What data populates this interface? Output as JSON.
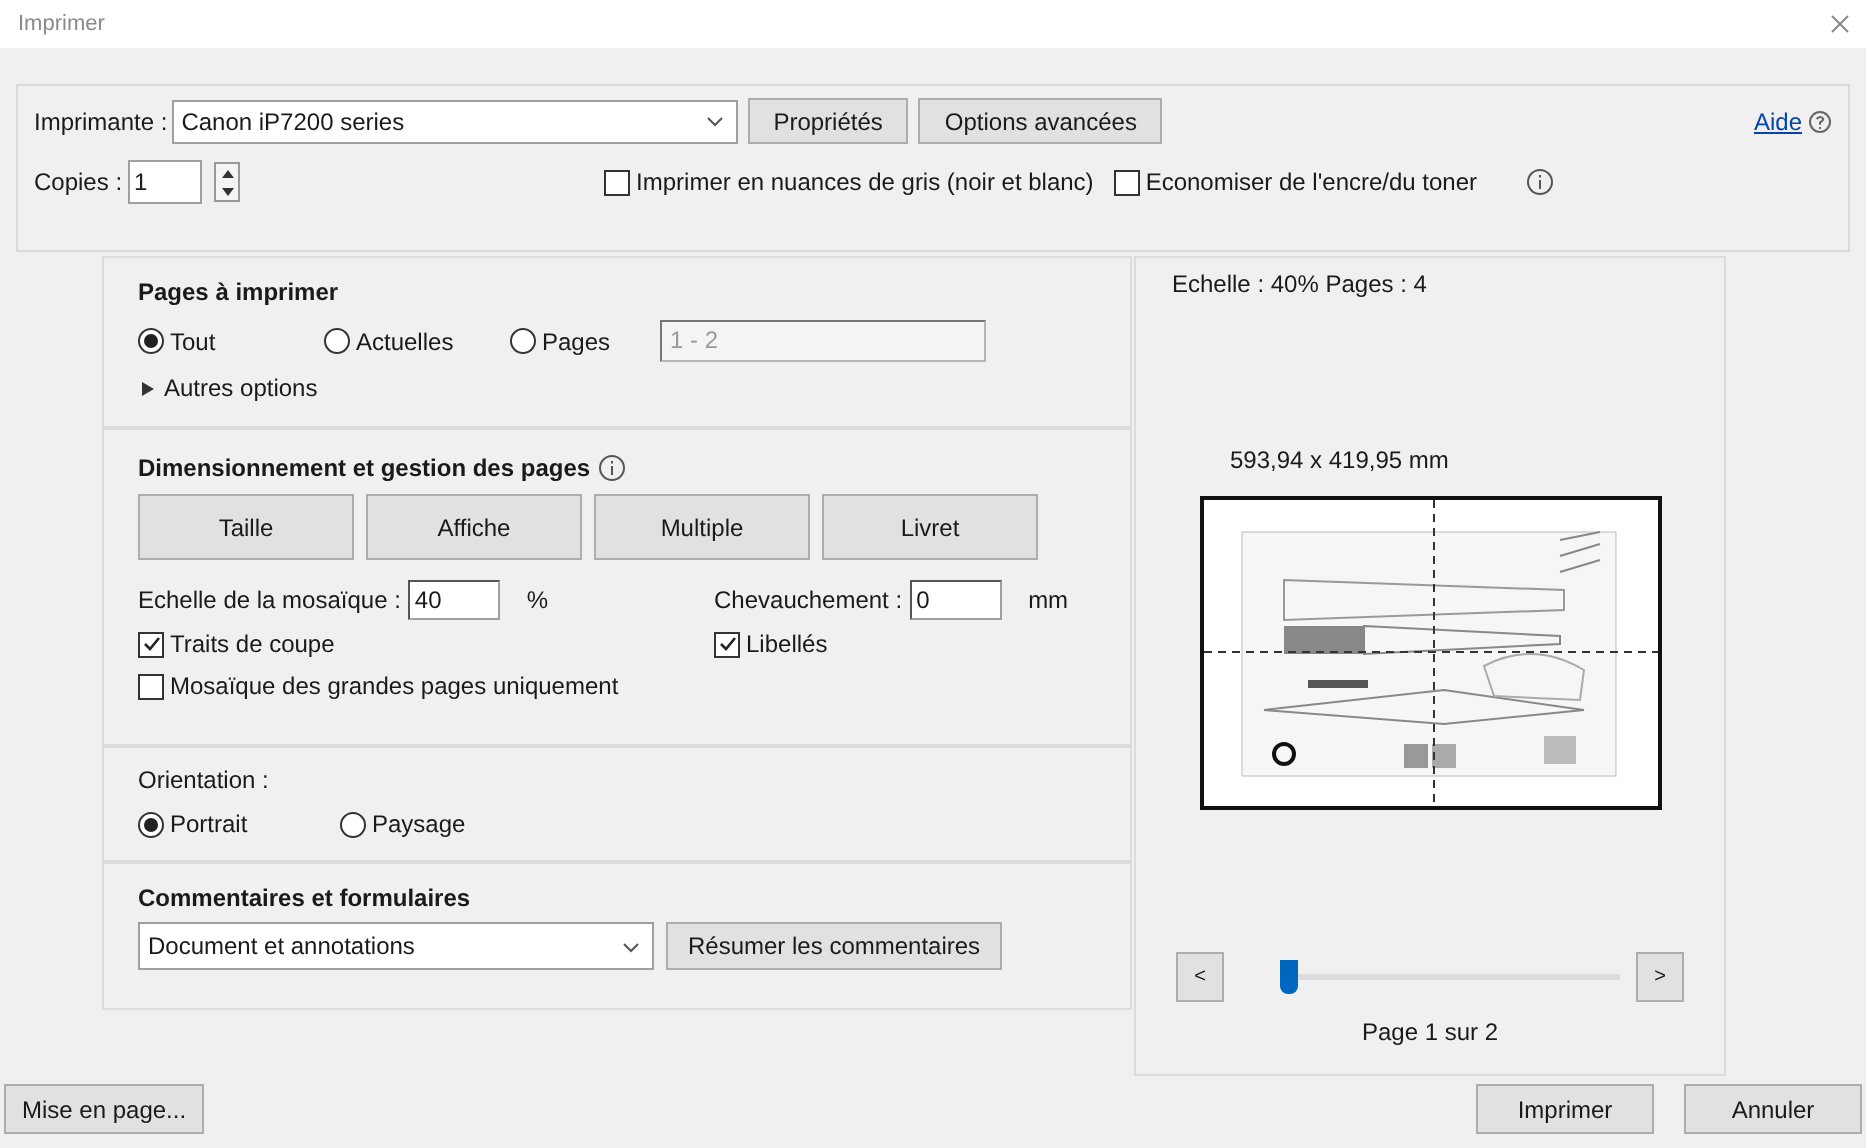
{
  "window": {
    "title": "Imprimer"
  },
  "printer": {
    "label": "Imprimante :",
    "value": "Canon iP7200 series",
    "buttons": [
      "Propriétés",
      "Options avancées"
    ],
    "help": "Aide"
  },
  "copies": {
    "label": "Copies :",
    "value": "1"
  },
  "print_options": [
    {
      "label": "Imprimer en nuances de gris (noir et blanc)",
      "checked": false
    },
    {
      "label": "Economiser de l'encre/du toner",
      "checked": false
    }
  ],
  "pages_to_print": {
    "title": "Pages à imprimer",
    "options": [
      {
        "label": "Tout",
        "selected": true
      },
      {
        "label": "Actuelles",
        "selected": false
      },
      {
        "label": "Pages",
        "selected": false
      }
    ],
    "range": "1 - 2",
    "more": "Autres options"
  },
  "sizing": {
    "title": "Dimensionnement et gestion des pages",
    "modes": [
      "Taille",
      "Affiche",
      "Multiple",
      "Livret"
    ],
    "tile_scale": {
      "label": "Echelle de la mosaïque :",
      "value": "40",
      "unit": "%"
    },
    "overlap": {
      "label": "Chevauchement :",
      "value": "0",
      "unit": "mm"
    },
    "checks": [
      {
        "label": "Traits de coupe",
        "checked": true
      },
      {
        "label": "Libellés",
        "checked": true
      },
      {
        "label": "Mosaïque des grandes pages uniquement",
        "checked": false
      }
    ]
  },
  "orientation": {
    "title": "Orientation :",
    "options": [
      {
        "label": "Portrait",
        "selected": true
      },
      {
        "label": "Paysage",
        "selected": false
      }
    ]
  },
  "comments": {
    "title": "Commentaires et formulaires",
    "value": "Document et annotations",
    "button": "Résumer les commentaires"
  },
  "preview": {
    "scale_info": "Echelle :  40% Pages : 4",
    "size": "593,94 x 419,95 mm",
    "prev": "<",
    "next": ">",
    "slider": {
      "level": 0
    },
    "page_label": "Page 1 sur 2"
  },
  "footer": {
    "setup": "Mise en page...",
    "buttons": [
      "Imprimer",
      "Annuler"
    ]
  }
}
